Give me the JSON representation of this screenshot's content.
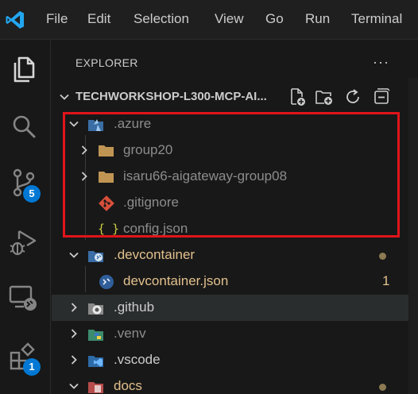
{
  "menu": [
    "File",
    "Edit",
    "Selection",
    "View",
    "Go",
    "Run",
    "Terminal"
  ],
  "activity": {
    "source_control_badge": "5",
    "extensions_badge": "1"
  },
  "explorer": {
    "title": "EXPLORER",
    "more": "···",
    "workspace": "TECHWORKSHOP-L300-MCP-AI...",
    "items": [
      {
        "label": ".azure",
        "state": "expanded"
      },
      {
        "label": "group20",
        "state": "collapsed"
      },
      {
        "label": "isaru66-aigateway-group08",
        "state": "collapsed"
      },
      {
        "label": ".gitignore",
        "state": "file"
      },
      {
        "label": "config.json",
        "state": "file"
      },
      {
        "label": ".devcontainer",
        "state": "expanded"
      },
      {
        "label": "devcontainer.json",
        "state": "file",
        "count": "1"
      },
      {
        "label": ".github",
        "state": "collapsed"
      },
      {
        "label": ".venv",
        "state": "collapsed"
      },
      {
        "label": ".vscode",
        "state": "collapsed"
      },
      {
        "label": "docs",
        "state": "expanded"
      }
    ],
    "json_glyph": "{ }"
  },
  "colors": {
    "accent": "#0078d4",
    "modified": "#e2c08d",
    "highlight_box": "#e0141b",
    "folder": "#c09553"
  }
}
